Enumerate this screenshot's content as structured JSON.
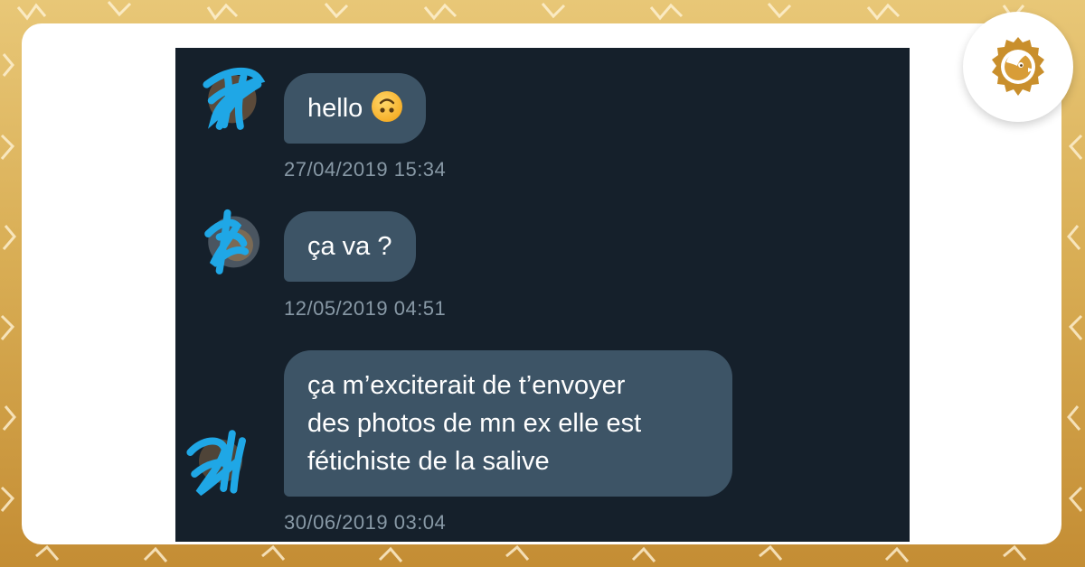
{
  "conversation": {
    "messages": [
      {
        "text": "hello",
        "emoji": "upside-down-face",
        "timestamp": "27/04/2019 15:34"
      },
      {
        "text": "ça va ?",
        "timestamp": "12/05/2019 04:51"
      },
      {
        "lines": [
          "ça m’exciterait de t’envoyer",
          "des photos de mn ex elle est",
          "fétichiste de la salive"
        ],
        "timestamp": "30/06/2019 03:04"
      }
    ]
  },
  "colors": {
    "screen_bg": "#15202b",
    "bubble_bg": "#3d5466",
    "timestamp": "#8899a6",
    "scribble": "#1fa7e6",
    "frame_gold": "#d9ae55",
    "logo_gold": "#c98f2c"
  },
  "icons": {
    "logo": "bird-head-gear-icon",
    "emoji": "upside-down-face-emoji"
  }
}
